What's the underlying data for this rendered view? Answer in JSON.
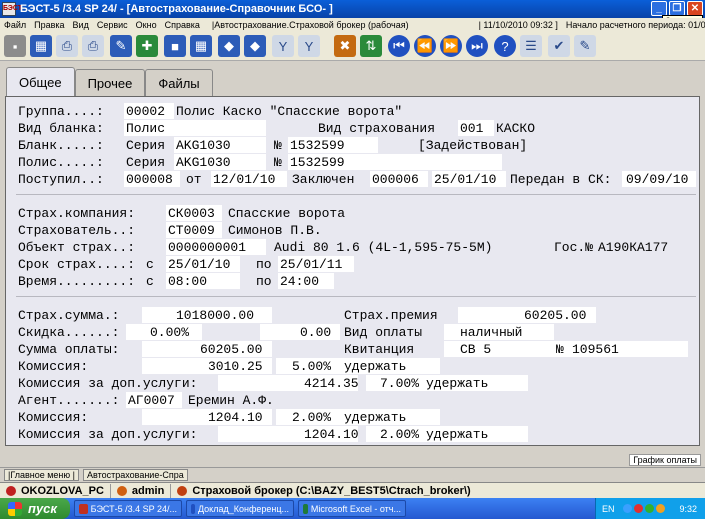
{
  "window": {
    "title": "БЭСТ-5 /3.4 SP 24/ - [Автострахование-Справочник БСО- ]",
    "app_icon_text": "БЭСТ",
    "tooltip": "Закрыть",
    "minimize": "_",
    "restore": "❐",
    "close": "✕"
  },
  "menubar": {
    "items": [
      "Файл",
      "Правка",
      "Вид",
      "Сервис",
      "Окно",
      "Справка"
    ],
    "module": "|Автострахование.Страховой брокер (рабочая)",
    "date": "| 11/10/2010 09:32 ]",
    "period": "Начало расчетного периода: 01/01/2010"
  },
  "toolbar": {
    "icons": [
      "exit-icon",
      "calendar-icon",
      "print-icon",
      "print-preview-icon",
      "edit-icon",
      "add-icon",
      "save-icon",
      "calculator-icon",
      "find-icon",
      "find-next-icon",
      "filter-icon",
      "filter-options-icon",
      "delete-icon",
      "sort-icon",
      "first-record-icon",
      "prev-record-icon",
      "next-record-icon",
      "last-record-icon",
      "help-icon",
      "list-icon",
      "mark-icon",
      "report-icon"
    ],
    "glyphs": [
      "▪",
      "▦",
      "⎙",
      "⎙",
      "✎",
      "✚",
      "■",
      "▦",
      "◆",
      "◆",
      "Y",
      "Y",
      "✖",
      "⇅",
      "⏮",
      "⏪",
      "⏩",
      "⏭",
      "?",
      "☰",
      "✔",
      "✎"
    ]
  },
  "tabs": [
    {
      "label": "Общее",
      "active": true
    },
    {
      "label": "Прочее",
      "active": false
    },
    {
      "label": "Файлы",
      "active": false
    }
  ],
  "form": {
    "group_label": "Группа....:",
    "group_code": "00002",
    "group_name": "Полис Каско \"Спасские ворота\"",
    "blank_type_label": "Вид бланка:",
    "blank_type": "Полис",
    "insurance_type_label": "Вид страхования",
    "insurance_type_code": "001",
    "insurance_type_name": "КАСКО",
    "blank_label": "Бланк.....:",
    "series_label": "Серия",
    "blank_series": "AKG1030",
    "number_sign": "№",
    "blank_number": "1532599",
    "blank_status": "[Задействован]",
    "policy_label": "Полис.....:",
    "policy_series": "AKG1030",
    "policy_number": "1532599",
    "received_label": "Поступил..:",
    "received_code": "000008",
    "from_label": "от",
    "received_date": "12/01/10",
    "concluded_label": "Заключен",
    "concluded_code": "000006",
    "concluded_date": "25/01/10",
    "transferred_label": "Передан в СК:",
    "transferred_date": "09/09/10",
    "company_label": "Страх.компания:",
    "company_code": "СК0003",
    "company_name": "Спасские ворота",
    "insurer_label": "Страхователь..:",
    "insurer_code": "СТ0009",
    "insurer_name": "Симонов П.В.",
    "object_label": "Объект страх..:",
    "object_code": "0000000001",
    "object_name": "Audi 80 1.6 (4L-1,595-75-5M)",
    "reg_label": "Гос.№",
    "reg_number": "А190КА177",
    "term_label": "Срок страх....:",
    "term_from_prefix": "с",
    "term_from": "25/01/10",
    "term_to_label": "по",
    "term_to": "25/01/11",
    "time_label": "Время.........:",
    "time_from_prefix": "с",
    "time_from": "08:00",
    "time_to_label": "по",
    "time_to": "24:00",
    "sum_label": "Страх.сумма.:",
    "sum_value": "1018000.00",
    "premium_label": "Страх.премия",
    "premium_value": "60205.00",
    "discount_label": "Скидка......:",
    "discount_pct": "0.00%",
    "discount_value": "0.00",
    "payment_type_label": "Вид оплаты",
    "payment_type": "наличный",
    "payment_sum_label": "Сумма оплаты:",
    "payment_sum": "60205.00",
    "receipt_label": "Квитанция",
    "receipt_series": "СВ 5",
    "receipt_number": "109561",
    "commission_label": "Комиссия:",
    "commission_value": "3010.25",
    "commission_pct": "5.00%",
    "commission_action": "удержать",
    "extra_label": "Комиссия за доп.услуги:",
    "extra_value": "4214.35",
    "extra_pct": "7.00%",
    "extra_action": "удержать",
    "agent_label": "Агент.......:",
    "agent_code": "АГ0007",
    "agent_name": "Еремин А.Ф.",
    "agent_commission_label": "Комиссия:",
    "agent_commission_value": "1204.10",
    "agent_commission_pct": "2.00%",
    "agent_commission_action": "удержать",
    "agent_extra_label": "Комиссия за доп.услуги:",
    "agent_extra_value": "1204.10",
    "agent_extra_pct": "2.00%",
    "agent_extra_action": "удержать"
  },
  "hint_button": "График оплаты",
  "window_tabs": [
    "|Главное меню |",
    "Автострахование-Спра"
  ],
  "status": {
    "user_pc": "OKOZLOVA_PC",
    "user": "admin",
    "module": "Страховой брокер (C:\\BAZY_BEST5\\Ctrach_broker\\)"
  },
  "taskbar": {
    "start": "пуск",
    "tasks": [
      {
        "label": "БЭСТ-5 /3.4 SP 24/...",
        "color": "#c03020"
      },
      {
        "label": "Доклад_Конференц...",
        "color": "#2050c0"
      },
      {
        "label": "Microsoft Excel - отч...",
        "color": "#1e7a3a"
      }
    ],
    "lang": "EN",
    "clock": "9:32"
  }
}
